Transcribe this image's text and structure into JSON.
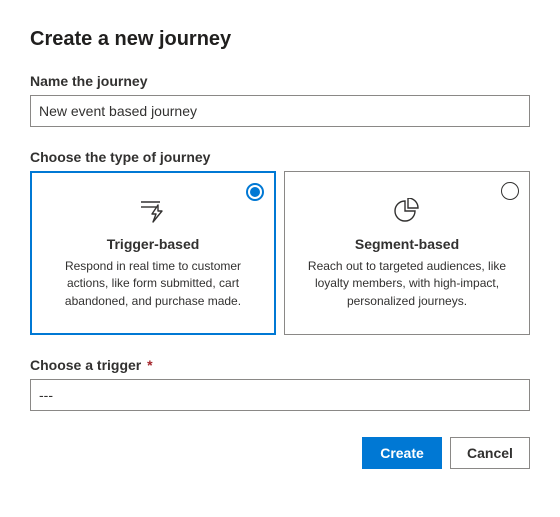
{
  "title": "Create a new journey",
  "name_field": {
    "label": "Name the journey",
    "value": "New event based journey"
  },
  "type_section": {
    "label": "Choose the type of journey",
    "options": [
      {
        "title": "Trigger-based",
        "desc": "Respond in real time to customer actions, like form submitted, cart abandoned, and purchase made.",
        "selected": true
      },
      {
        "title": "Segment-based",
        "desc": "Reach out to targeted audiences, like loyalty members, with high-impact, personalized journeys.",
        "selected": false
      }
    ]
  },
  "trigger_section": {
    "label": "Choose a trigger",
    "required_mark": "*",
    "value": "---"
  },
  "actions": {
    "primary": "Create",
    "secondary": "Cancel"
  }
}
